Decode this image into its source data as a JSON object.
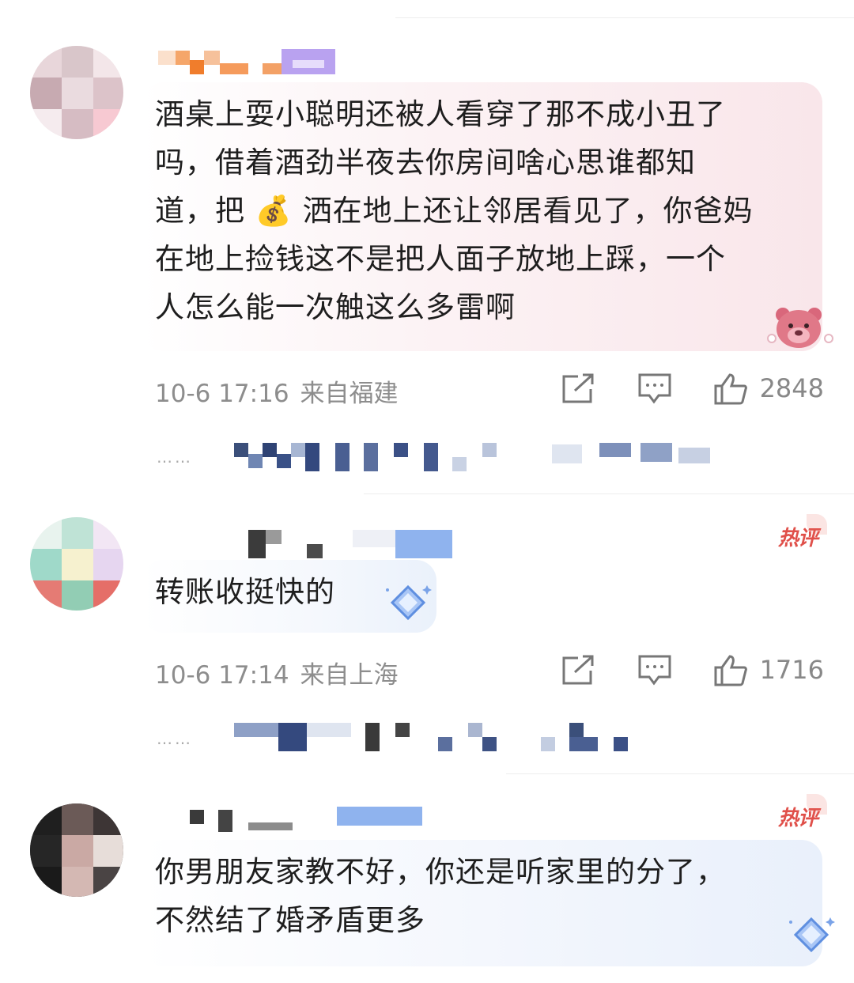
{
  "comments": [
    {
      "text": "酒桌上耍小聪明还被人看穿了那不成小丑了\n吗，借着酒劲半夜去你房间啥心思谁都知\n道，把 💰 洒在地上还让邻居看见了，你爸妈\n在地上捡钱这不是把人面子放地上踩，一个\n人怎么能一次触这么多雷啊",
      "time": "10-6 17:16",
      "location": "来自福建",
      "likes": "2848",
      "badge": ""
    },
    {
      "text": "转账收挺快的",
      "time": "10-6 17:14",
      "location": "来自上海",
      "likes": "1716",
      "badge": "热评"
    },
    {
      "text": "你男朋友家教不好，你还是听家里的分了，\n不然结了婚矛盾更多",
      "time": "",
      "location": "",
      "likes": "",
      "badge": "热评"
    }
  ],
  "icons": {
    "share": "share-icon",
    "comment": "comment-icon",
    "like": "thumbs-up-icon",
    "more": "more-dots-icon",
    "money": "money-bag-emoji"
  },
  "reply_more": "……",
  "colors": {
    "bubble_pink": "#fcedf0",
    "bubble_blue": "#eef3fb",
    "badge_red": "#e0504a",
    "meta_gray": "#8d8d8d"
  }
}
